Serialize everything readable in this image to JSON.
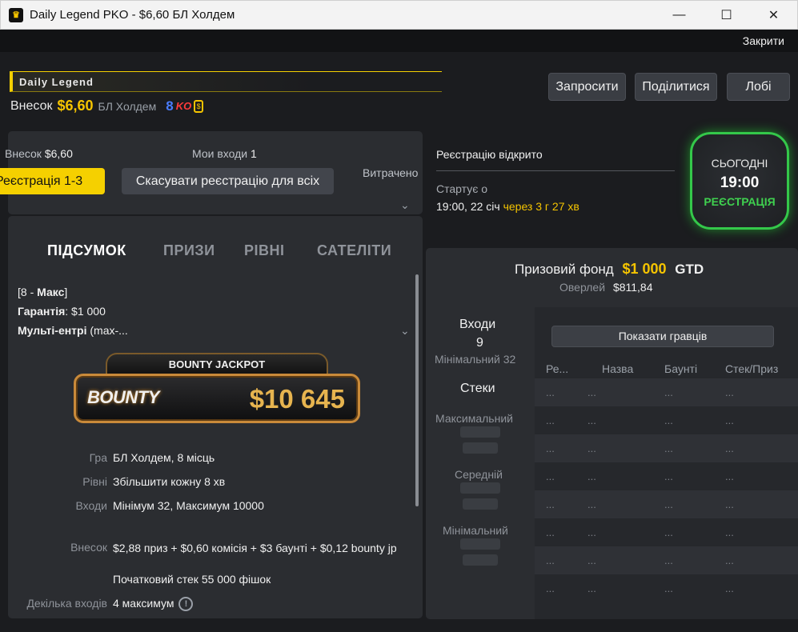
{
  "window": {
    "title": "Daily Legend PKO - $6,60 БЛ Холдем",
    "minimize": "—",
    "maximize": "☐",
    "close": "✕"
  },
  "header": {
    "close_link": "Закрити",
    "logo_text": "Daily Legend",
    "buyin_label": "Внесок",
    "buyin_amount": "$6,60",
    "game": "БЛ Холдем",
    "ko_number": "8",
    "ko_text": "KO",
    "buttons": {
      "invite": "Запросити",
      "share": "Поділитися",
      "lobby": "Лобі"
    }
  },
  "registration": {
    "fee_label": "Внесок",
    "fee_value": "$6,60",
    "entries_label": "Мои входи",
    "entries_value": "1",
    "spent_label": "Витрачено",
    "register_button": "Реєстрація 1-3",
    "cancel_all_button": "Скасувати реєстрацію для всіх"
  },
  "tabs": [
    "ПІДСУМОК",
    "ПРИЗИ",
    "РІВНІ",
    "САТЕЛІТИ"
  ],
  "summary": {
    "line1_prefix": "[8 - ",
    "line1_bold": "Макс",
    "line1_suffix": "]",
    "guarantee_label": "Гарантія",
    "guarantee_value": ": $1 000",
    "multi_label": "Мульті-ентрі",
    "multi_value": " (max-..."
  },
  "jackpot": {
    "title": "BOUNTY JACKPOT",
    "logo": "BOUNTY",
    "amount": "$10 645"
  },
  "details": [
    {
      "label": "Гра",
      "value": "БЛ Холдем, 8 місць"
    },
    {
      "label": "Рівні",
      "value": "Збільшити кожну 8 хв"
    },
    {
      "label": "Входи",
      "value": "Мінімум 32, Максимум 10000"
    },
    {
      "label": "Внесок",
      "value": "$2,88 приз + $0,60 комісія + $3 баунті + $0,12 bounty jp"
    },
    {
      "label": "",
      "value": "Початковий стек 55 000 фішок"
    },
    {
      "label": "Декілька входів",
      "value": "4 максимум"
    }
  ],
  "status": {
    "registration_open": "Реєстрацію відкрито",
    "starts_label": "Стартує о",
    "starts_value": "19:00, 22 січ",
    "starts_in": "через 3 г 27 хв"
  },
  "clock": {
    "day": "СЬОГОДНІ",
    "time": "19:00",
    "status": "РЕЄСТРАЦІЯ"
  },
  "prize": {
    "label": "Призовий фонд",
    "amount": "$1 000",
    "gtd": "GTD",
    "overlay_label": "Оверлей",
    "overlay_value": "$811,84"
  },
  "entries": {
    "label": "Входи",
    "value": "9",
    "minimum": "Мінімальний 32"
  },
  "stacks": {
    "label": "Стеки",
    "max": "Максимальний",
    "avg": "Середній",
    "min": "Мінімальний"
  },
  "players_table": {
    "show_players_button": "Показати гравців",
    "columns": [
      "Ре...",
      "Назва",
      "Баунті",
      "Стек/Приз"
    ],
    "placeholder": "..."
  },
  "colors": {
    "accent_yellow": "#f5d000",
    "gold": "#f5c400",
    "green": "#34c84a",
    "panel": "#2b2d31",
    "background": "#1b1c1f"
  }
}
